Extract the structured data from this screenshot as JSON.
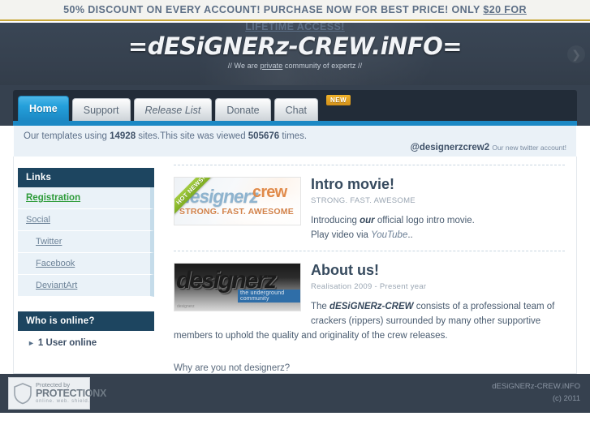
{
  "promo": {
    "line1": "50% DISCOUNT ON EVERY ACCOUNT! PURCHASE NOW FOR BEST PRICE! ONLY ",
    "link": "$20 FOR",
    "line2": "LIFETIME ACCESS!"
  },
  "header": {
    "logo": "=dESiGNERz-CREW.iNFO=",
    "tagline_pre": "// We are ",
    "tagline_underline": "private",
    "tagline_post": " community of expertz //",
    "arrow_icon": "chevron-right-icon"
  },
  "nav": {
    "tabs": [
      {
        "label": "Home",
        "active": true,
        "italic": false,
        "badge": ""
      },
      {
        "label": "Support",
        "active": false,
        "italic": false,
        "badge": ""
      },
      {
        "label": "Release List",
        "active": false,
        "italic": true,
        "badge": ""
      },
      {
        "label": "Donate",
        "active": false,
        "italic": false,
        "badge": ""
      },
      {
        "label": "Chat",
        "active": false,
        "italic": false,
        "badge": "NEW"
      }
    ]
  },
  "stats": {
    "prefix": "Our templates using ",
    "templates_count": "14928",
    "middle": " sites.This site was viewed ",
    "views_count": "505676",
    "suffix": " times.",
    "twitter_handle": "@designerzcrew2",
    "twitter_note": "Our new twitter account!"
  },
  "sidebar": {
    "links_title": "Links",
    "links": [
      {
        "label": "Registration",
        "style": "reg"
      },
      {
        "label": "Social",
        "style": "normal"
      },
      {
        "label": "Twitter",
        "style": "sub"
      },
      {
        "label": "Facebook",
        "style": "sub"
      },
      {
        "label": "DeviantArt",
        "style": "sub"
      }
    ],
    "online_title": "Who is online?",
    "online_count": "1 User online"
  },
  "posts": [
    {
      "title": "Intro movie!",
      "meta": "STRONG. FAST. AWESOME",
      "body_pre": "Introducing ",
      "body_bold": "our",
      "body_mid": " official logo intro movie.",
      "body_line2_pre": "Play video via ",
      "body_link": "YouTube",
      "body_line2_post": "..",
      "thumb": {
        "ribbon": "HOT NEWS!",
        "word_a": "designerz",
        "word_b": "crew",
        "tagline": "STRONG. FAST. AWESOME"
      }
    },
    {
      "title": "About us!",
      "meta": "Realisation 2009 - Present year",
      "body_pre": "The ",
      "body_bold": "dESiGNERz-CREW",
      "body_mid": " consists of a professional team of crackers (rippers) surrounded by many other supportive members to uphold the quality and originality of the crew releases.",
      "thumb": {
        "word": "designerz",
        "sub": "the underground community",
        "corner": "designerz"
      }
    }
  ],
  "footnote": "Why are you not designerz?",
  "footer": {
    "badge_icon": "shield-icon",
    "badge_line1": "Protected by",
    "badge_line2": "PROTECTIONX",
    "badge_line3": "online. web. shield.",
    "site": "dESiGNERz-CREW.iNFO",
    "copyright": "(c) 2011"
  },
  "colors": {
    "header_dark": "#36414f",
    "nav_inner": "#222c38",
    "accent_blue": "#1b88c4",
    "sidebar_head": "#1d4560",
    "registration_green": "#2d9b39",
    "badge_gold": "#d2901a",
    "promo_border": "#c9a83a"
  }
}
